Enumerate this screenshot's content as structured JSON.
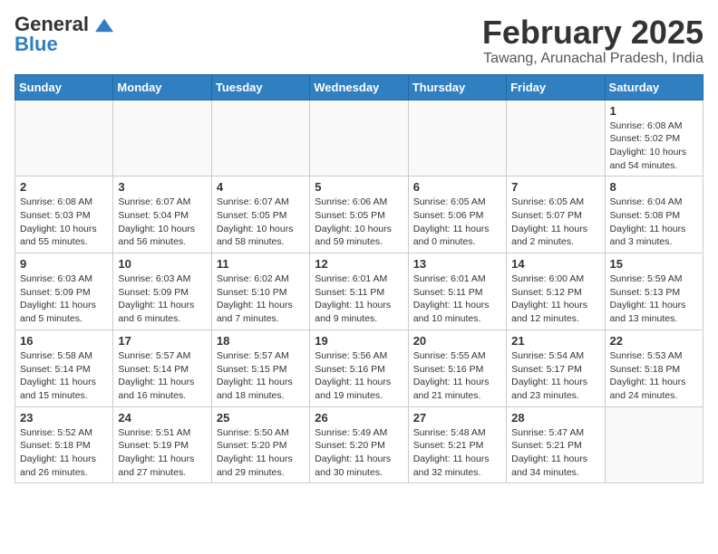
{
  "header": {
    "logo_general": "General",
    "logo_blue": "Blue",
    "month_title": "February 2025",
    "location": "Tawang, Arunachal Pradesh, India"
  },
  "weekdays": [
    "Sunday",
    "Monday",
    "Tuesday",
    "Wednesday",
    "Thursday",
    "Friday",
    "Saturday"
  ],
  "weeks": [
    [
      {
        "day": "",
        "info": ""
      },
      {
        "day": "",
        "info": ""
      },
      {
        "day": "",
        "info": ""
      },
      {
        "day": "",
        "info": ""
      },
      {
        "day": "",
        "info": ""
      },
      {
        "day": "",
        "info": ""
      },
      {
        "day": "1",
        "info": "Sunrise: 6:08 AM\nSunset: 5:02 PM\nDaylight: 10 hours\nand 54 minutes."
      }
    ],
    [
      {
        "day": "2",
        "info": "Sunrise: 6:08 AM\nSunset: 5:03 PM\nDaylight: 10 hours\nand 55 minutes."
      },
      {
        "day": "3",
        "info": "Sunrise: 6:07 AM\nSunset: 5:04 PM\nDaylight: 10 hours\nand 56 minutes."
      },
      {
        "day": "4",
        "info": "Sunrise: 6:07 AM\nSunset: 5:05 PM\nDaylight: 10 hours\nand 58 minutes."
      },
      {
        "day": "5",
        "info": "Sunrise: 6:06 AM\nSunset: 5:05 PM\nDaylight: 10 hours\nand 59 minutes."
      },
      {
        "day": "6",
        "info": "Sunrise: 6:05 AM\nSunset: 5:06 PM\nDaylight: 11 hours\nand 0 minutes."
      },
      {
        "day": "7",
        "info": "Sunrise: 6:05 AM\nSunset: 5:07 PM\nDaylight: 11 hours\nand 2 minutes."
      },
      {
        "day": "8",
        "info": "Sunrise: 6:04 AM\nSunset: 5:08 PM\nDaylight: 11 hours\nand 3 minutes."
      }
    ],
    [
      {
        "day": "9",
        "info": "Sunrise: 6:03 AM\nSunset: 5:09 PM\nDaylight: 11 hours\nand 5 minutes."
      },
      {
        "day": "10",
        "info": "Sunrise: 6:03 AM\nSunset: 5:09 PM\nDaylight: 11 hours\nand 6 minutes."
      },
      {
        "day": "11",
        "info": "Sunrise: 6:02 AM\nSunset: 5:10 PM\nDaylight: 11 hours\nand 7 minutes."
      },
      {
        "day": "12",
        "info": "Sunrise: 6:01 AM\nSunset: 5:11 PM\nDaylight: 11 hours\nand 9 minutes."
      },
      {
        "day": "13",
        "info": "Sunrise: 6:01 AM\nSunset: 5:11 PM\nDaylight: 11 hours\nand 10 minutes."
      },
      {
        "day": "14",
        "info": "Sunrise: 6:00 AM\nSunset: 5:12 PM\nDaylight: 11 hours\nand 12 minutes."
      },
      {
        "day": "15",
        "info": "Sunrise: 5:59 AM\nSunset: 5:13 PM\nDaylight: 11 hours\nand 13 minutes."
      }
    ],
    [
      {
        "day": "16",
        "info": "Sunrise: 5:58 AM\nSunset: 5:14 PM\nDaylight: 11 hours\nand 15 minutes."
      },
      {
        "day": "17",
        "info": "Sunrise: 5:57 AM\nSunset: 5:14 PM\nDaylight: 11 hours\nand 16 minutes."
      },
      {
        "day": "18",
        "info": "Sunrise: 5:57 AM\nSunset: 5:15 PM\nDaylight: 11 hours\nand 18 minutes."
      },
      {
        "day": "19",
        "info": "Sunrise: 5:56 AM\nSunset: 5:16 PM\nDaylight: 11 hours\nand 19 minutes."
      },
      {
        "day": "20",
        "info": "Sunrise: 5:55 AM\nSunset: 5:16 PM\nDaylight: 11 hours\nand 21 minutes."
      },
      {
        "day": "21",
        "info": "Sunrise: 5:54 AM\nSunset: 5:17 PM\nDaylight: 11 hours\nand 23 minutes."
      },
      {
        "day": "22",
        "info": "Sunrise: 5:53 AM\nSunset: 5:18 PM\nDaylight: 11 hours\nand 24 minutes."
      }
    ],
    [
      {
        "day": "23",
        "info": "Sunrise: 5:52 AM\nSunset: 5:18 PM\nDaylight: 11 hours\nand 26 minutes."
      },
      {
        "day": "24",
        "info": "Sunrise: 5:51 AM\nSunset: 5:19 PM\nDaylight: 11 hours\nand 27 minutes."
      },
      {
        "day": "25",
        "info": "Sunrise: 5:50 AM\nSunset: 5:20 PM\nDaylight: 11 hours\nand 29 minutes."
      },
      {
        "day": "26",
        "info": "Sunrise: 5:49 AM\nSunset: 5:20 PM\nDaylight: 11 hours\nand 30 minutes."
      },
      {
        "day": "27",
        "info": "Sunrise: 5:48 AM\nSunset: 5:21 PM\nDaylight: 11 hours\nand 32 minutes."
      },
      {
        "day": "28",
        "info": "Sunrise: 5:47 AM\nSunset: 5:21 PM\nDaylight: 11 hours\nand 34 minutes."
      },
      {
        "day": "",
        "info": ""
      }
    ]
  ]
}
